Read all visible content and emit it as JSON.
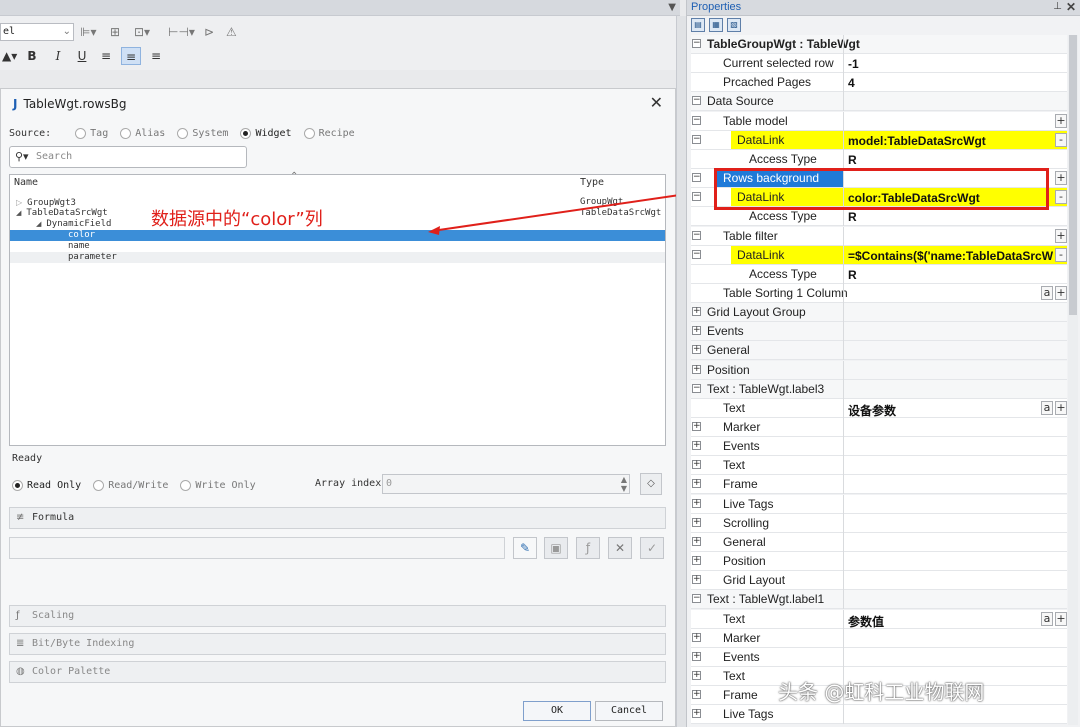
{
  "toolbar": {
    "font_combo_value": "el",
    "format_buttons": [
      "B",
      "I",
      "U"
    ]
  },
  "dialog": {
    "title": "TableWgt.rowsBg",
    "source_label": "Source:",
    "source_options": [
      "Tag",
      "Alias",
      "System",
      "Widget",
      "Recipe"
    ],
    "source_selected": "Widget",
    "search_placeholder": "Search",
    "tree_header_name": "Name",
    "tree_header_type": "Type",
    "tree_rows": [
      {
        "name": "GroupWgt3",
        "type": "GroupWgt",
        "expander": "▷"
      },
      {
        "name": "TableDataSrcWgt",
        "type": "TableDataSrcWgt",
        "expander": "◢"
      },
      {
        "name": "DynamicField",
        "type": "",
        "expander": "◢"
      },
      {
        "name": "color",
        "type": ""
      },
      {
        "name": "name",
        "type": ""
      },
      {
        "name": "parameter",
        "type": ""
      }
    ],
    "annotation": "数据源中的“color”列",
    "status": "Ready",
    "access_modes": [
      "Read Only",
      "Read/Write",
      "Write Only"
    ],
    "access_selected": "Read Only",
    "array_index_label": "Array index",
    "array_index_value": "0",
    "sections": [
      "Formula",
      "Scaling",
      "Bit/Byte Indexing",
      "Color Palette"
    ],
    "ok_label": "OK",
    "cancel_label": "Cancel"
  },
  "properties": {
    "title": "Properties",
    "rows": [
      {
        "name": "TableGroupWgt : TableWgt",
        "value": "",
        "level": 0,
        "exp": "−",
        "cat": true,
        "bold": true
      },
      {
        "name": "Current selected row",
        "value": "-1",
        "level": 1,
        "exp": ""
      },
      {
        "name": "Prcached Pages",
        "value": "4",
        "level": 1,
        "exp": ""
      },
      {
        "name": "Data Source",
        "value": "",
        "level": 0,
        "exp": "−",
        "cat": true
      },
      {
        "name": "Table model",
        "value": "",
        "level": 1,
        "exp": "−",
        "btn": "+"
      },
      {
        "name": "DataLink",
        "value": "model:TableDataSrcWgt",
        "level": 2,
        "exp": "−",
        "hl": true,
        "btn": "-"
      },
      {
        "name": "Access Type",
        "value": "R",
        "level": 3,
        "exp": ""
      },
      {
        "name": "Rows background",
        "value": "",
        "level": 1,
        "exp": "−",
        "blue": true,
        "btn": "+"
      },
      {
        "name": "DataLink",
        "value": "color:TableDataSrcWgt",
        "level": 2,
        "exp": "−",
        "hl": true,
        "btn": "-"
      },
      {
        "name": "Access Type",
        "value": "R",
        "level": 3,
        "exp": ""
      },
      {
        "name": "Table filter",
        "value": "",
        "level": 1,
        "exp": "−",
        "btn": "+"
      },
      {
        "name": "DataLink",
        "value": "=$Contains($('name:TableDataSrcW",
        "level": 2,
        "exp": "−",
        "hl": true,
        "btn": "-"
      },
      {
        "name": "Access Type",
        "value": "R",
        "level": 3,
        "exp": ""
      },
      {
        "name": "Table Sorting 1 Column",
        "value": "",
        "level": 1,
        "exp": "",
        "btn2": true
      },
      {
        "name": "Grid Layout Group",
        "value": "",
        "level": 0,
        "exp": "+",
        "cat": true
      },
      {
        "name": "Events",
        "value": "",
        "level": 0,
        "exp": "+",
        "cat": true
      },
      {
        "name": "General",
        "value": "",
        "level": 0,
        "exp": "+",
        "cat": true
      },
      {
        "name": "Position",
        "value": "",
        "level": 0,
        "exp": "+",
        "cat": true
      },
      {
        "name": "Text : TableWgt.label3",
        "value": "",
        "level": 0,
        "exp": "−",
        "cat": true
      },
      {
        "name": "Text",
        "value": "设备参数",
        "level": 1,
        "exp": "",
        "btn2": true
      },
      {
        "name": "Marker",
        "value": "",
        "level": 1,
        "exp": "+"
      },
      {
        "name": "Events",
        "value": "",
        "level": 1,
        "exp": "+"
      },
      {
        "name": "Text",
        "value": "",
        "level": 1,
        "exp": "+"
      },
      {
        "name": "Frame",
        "value": "",
        "level": 1,
        "exp": "+"
      },
      {
        "name": "Live Tags",
        "value": "",
        "level": 1,
        "exp": "+"
      },
      {
        "name": "Scrolling",
        "value": "",
        "level": 1,
        "exp": "+"
      },
      {
        "name": "General",
        "value": "",
        "level": 1,
        "exp": "+"
      },
      {
        "name": "Position",
        "value": "",
        "level": 1,
        "exp": "+"
      },
      {
        "name": "Grid Layout",
        "value": "",
        "level": 1,
        "exp": "+"
      },
      {
        "name": "Text : TableWgt.label1",
        "value": "",
        "level": 0,
        "exp": "−",
        "cat": true
      },
      {
        "name": "Text",
        "value": "参数值",
        "level": 1,
        "exp": "",
        "btn2": true
      },
      {
        "name": "Marker",
        "value": "",
        "level": 1,
        "exp": "+"
      },
      {
        "name": "Events",
        "value": "",
        "level": 1,
        "exp": "+"
      },
      {
        "name": "Text",
        "value": "",
        "level": 1,
        "exp": "+"
      },
      {
        "name": "Frame",
        "value": "",
        "level": 1,
        "exp": "+"
      },
      {
        "name": "Live Tags",
        "value": "",
        "level": 1,
        "exp": "+"
      }
    ]
  },
  "watermark": "头条 @虹科工业物联网"
}
